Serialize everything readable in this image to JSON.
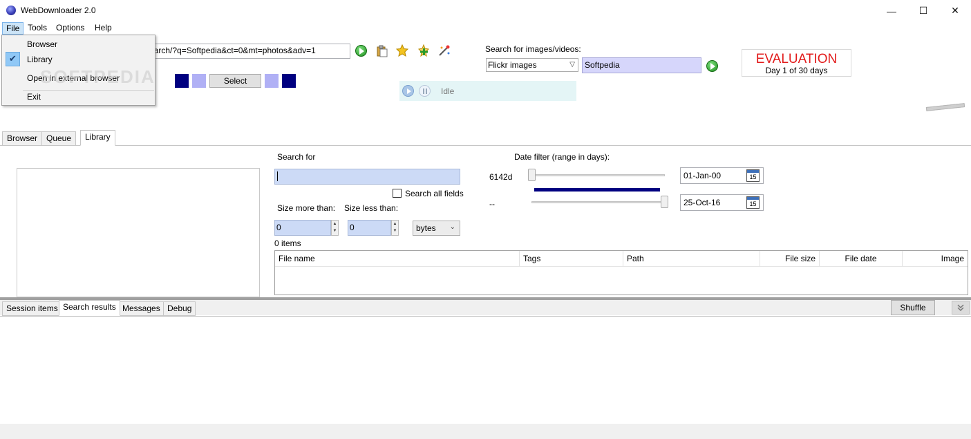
{
  "window": {
    "title": "WebDownloader 2.0",
    "minimize": "—",
    "maximize": "☐",
    "close": "✕"
  },
  "menu": {
    "file": "File",
    "tools": "Tools",
    "options": "Options",
    "help": "Help"
  },
  "file_menu": {
    "items": [
      "Browser",
      "Library",
      "Open in external browser",
      "Exit"
    ],
    "checked": "Library",
    "check_glyph": "✔"
  },
  "toolbar": {
    "url": "earch/?q=Softpedia&ct=0&mt=photos&adv=1",
    "select_label": "Select",
    "swatch_colors": [
      "#000080",
      "#b0b0f5",
      "#b0b0f5",
      "#000080"
    ],
    "icons": [
      "go-icon",
      "paste-icon",
      "star-icon",
      "add-icon",
      "magic-icon"
    ]
  },
  "watermark": "SOFTPEDIA",
  "image_search": {
    "label": "Search for images/videos:",
    "source": "Flickr images",
    "query": "Softpedia"
  },
  "evaluation": {
    "title": "EVALUATION",
    "days": "Day 1 of 30 days"
  },
  "status": {
    "text": "Idle"
  },
  "tabs": [
    "Browser",
    "Queue",
    "Library"
  ],
  "active_tab": "Library",
  "library": {
    "search_for_label": "Search for",
    "search_value": "",
    "search_all_label": "Search all fields",
    "size_more_label": "Size more than:",
    "size_less_label": "Size less than:",
    "size_more_value": "0",
    "size_less_value": "0",
    "size_unit": "bytes",
    "items_count": "0 items",
    "date_filter_label": "Date filter (range in days):",
    "days_value": "6142d",
    "days_value2": "--",
    "date_from": "01-Jan-00",
    "date_to": "25-Oct-16",
    "calendar_day": "15",
    "columns": [
      "File name",
      "Tags",
      "Path",
      "File size",
      "File date",
      "Image"
    ]
  },
  "bottom_tabs": [
    "Session items",
    "Search results",
    "Messages",
    "Debug"
  ],
  "active_bottom_tab": "Search results",
  "shuffle_label": "Shuffle",
  "collapse_glyph": "⌄"
}
